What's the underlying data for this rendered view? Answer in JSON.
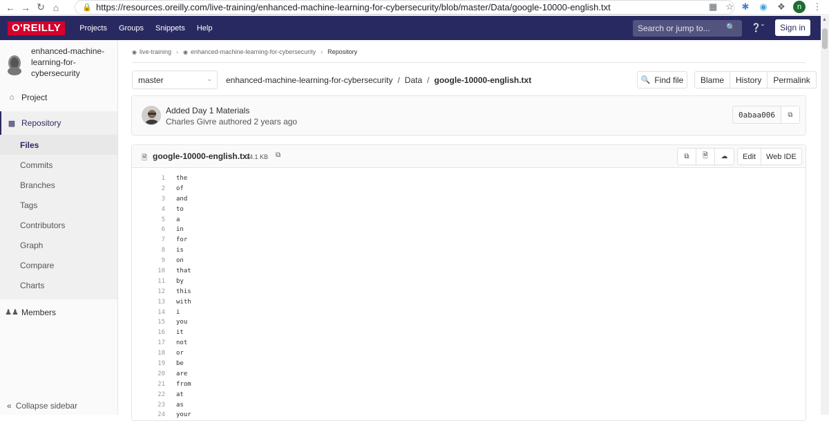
{
  "browser": {
    "url": "https://resources.oreilly.com/live-training/enhanced-machine-learning-for-cybersecurity/blob/master/Data/google-10000-english.txt",
    "profile_initial": "n"
  },
  "topnav": {
    "logo": "O'REILLY",
    "links": [
      "Projects",
      "Groups",
      "Snippets",
      "Help"
    ],
    "search_placeholder": "Search or jump to...",
    "signin_label": "Sign in"
  },
  "sidebar": {
    "project_name": "enhanced-machine-learning-for-cybersecurity",
    "project_label": "Project",
    "repository_label": "Repository",
    "repo_items": [
      "Files",
      "Commits",
      "Branches",
      "Tags",
      "Contributors",
      "Graph",
      "Compare",
      "Charts"
    ],
    "members_label": "Members",
    "collapse_label": "Collapse sidebar"
  },
  "breadcrumb": {
    "items": [
      "live-training",
      "enhanced-machine-learning-for-cybersecurity"
    ],
    "current": "Repository"
  },
  "toolbar": {
    "branch": "master",
    "path_repo": "enhanced-machine-learning-for-cybersecurity",
    "path_dir": "Data",
    "path_file": "google-10000-english.txt",
    "find_file": "Find file",
    "blame": "Blame",
    "history": "History",
    "permalink": "Permalink"
  },
  "commit": {
    "title": "Added Day 1 Materials",
    "meta": "Charles Givre authored 2 years ago",
    "sha": "0abaa006"
  },
  "file": {
    "name": "google-10000-english.txt",
    "size": "74.1 KB",
    "edit_label": "Edit",
    "webide_label": "Web IDE",
    "lines": [
      "the",
      "of",
      "and",
      "to",
      "a",
      "in",
      "for",
      "is",
      "on",
      "that",
      "by",
      "this",
      "with",
      "i",
      "you",
      "it",
      "not",
      "or",
      "be",
      "are",
      "from",
      "at",
      "as",
      "your"
    ]
  }
}
